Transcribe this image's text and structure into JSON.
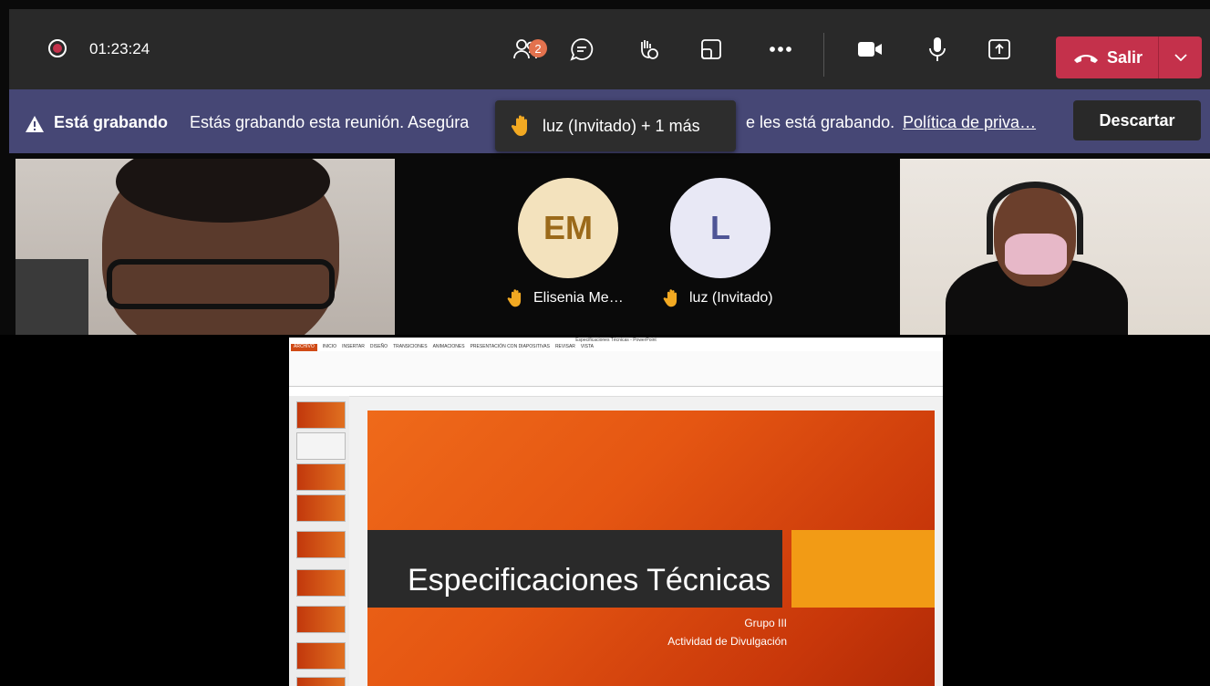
{
  "recording": {
    "timer": "01:23:24"
  },
  "toolbar": {
    "participants_badge": "2",
    "leave_label": "Salir"
  },
  "banner": {
    "title": "Está grabando",
    "text": "Estás grabando esta reunión. Asegúra",
    "text_after": "e les está grabando.",
    "link": "Política de priva…",
    "dismiss_label": "Descartar"
  },
  "tooltip": {
    "text": "luz (Invitado) + 1 más"
  },
  "participants": [
    {
      "initials": "EM",
      "name": "Elisenia Me…"
    },
    {
      "initials": "L",
      "name": "luz (Invitado)"
    }
  ],
  "presentation": {
    "window_title": "Especificaciones Técnicas - PowerPoint",
    "tabs": [
      "ARCHIVO",
      "INICIO",
      "INSERTAR",
      "DISEÑO",
      "TRANSICIONES",
      "ANIMACIONES",
      "PRESENTACIÓN CON DIAPOSITIVAS",
      "REVISAR",
      "VISTA"
    ],
    "slide_title": "Especificaciones Técnicas",
    "slide_subtitle_1": "Grupo III",
    "slide_subtitle_2": "Actividad de Divulgación"
  },
  "colors": {
    "leave": "#c4314b",
    "banner": "#464775",
    "topbar": "#292929"
  }
}
